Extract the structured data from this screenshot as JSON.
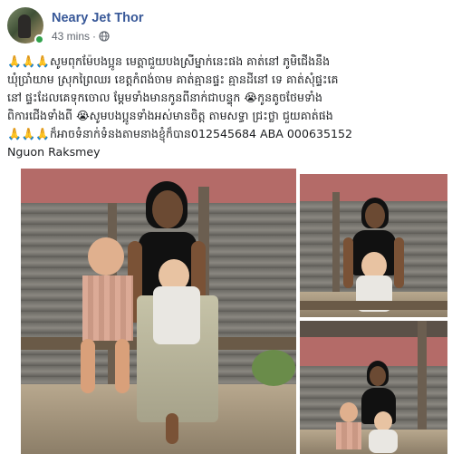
{
  "post": {
    "author": "Neary Jet Thor",
    "time": "43 mins",
    "privacy_icon": "globe-icon",
    "online_status_color": "#31a24c",
    "text_lines": [
      "🙏🙏🙏សូមពុកម៉ែបងប្អូន មេត្តាជួយបងស្រីម្នាក់នេះផង គាត់នៅ ភូមិជើងនឹង",
      "ឃុំប្រាំយាម ស្រុកព្រៃឈរ ខេត្តកំពង់ចាម គាត់គ្មានផ្ទះ គ្មានដីនៅ ទេ គាត់សុំផ្ទះគេ",
      "នៅ ផ្ទះដែលគេទុកចោល ម្ដែមទាំងមានកូនពីនាក់ជាបន្ទុក 😭កូនតូចថែមទាំង",
      "ពិការជើងទាំងពី 😭សូមបងប្អូនទាំងអស់មានចិត្ត តាមសទ្ធា ជ្រះថ្លា ជួយគាត់ផង",
      "🙏🙏🙏ក៏អាចទំនាក់ទំនងតាមនាងខ្ញុំក៏បាន012545684 ABA 000635152",
      "Nguon Raksmey"
    ]
  },
  "colors": {
    "author_link": "#385898",
    "meta_text": "#616770",
    "body_text": "#1c1e21"
  }
}
